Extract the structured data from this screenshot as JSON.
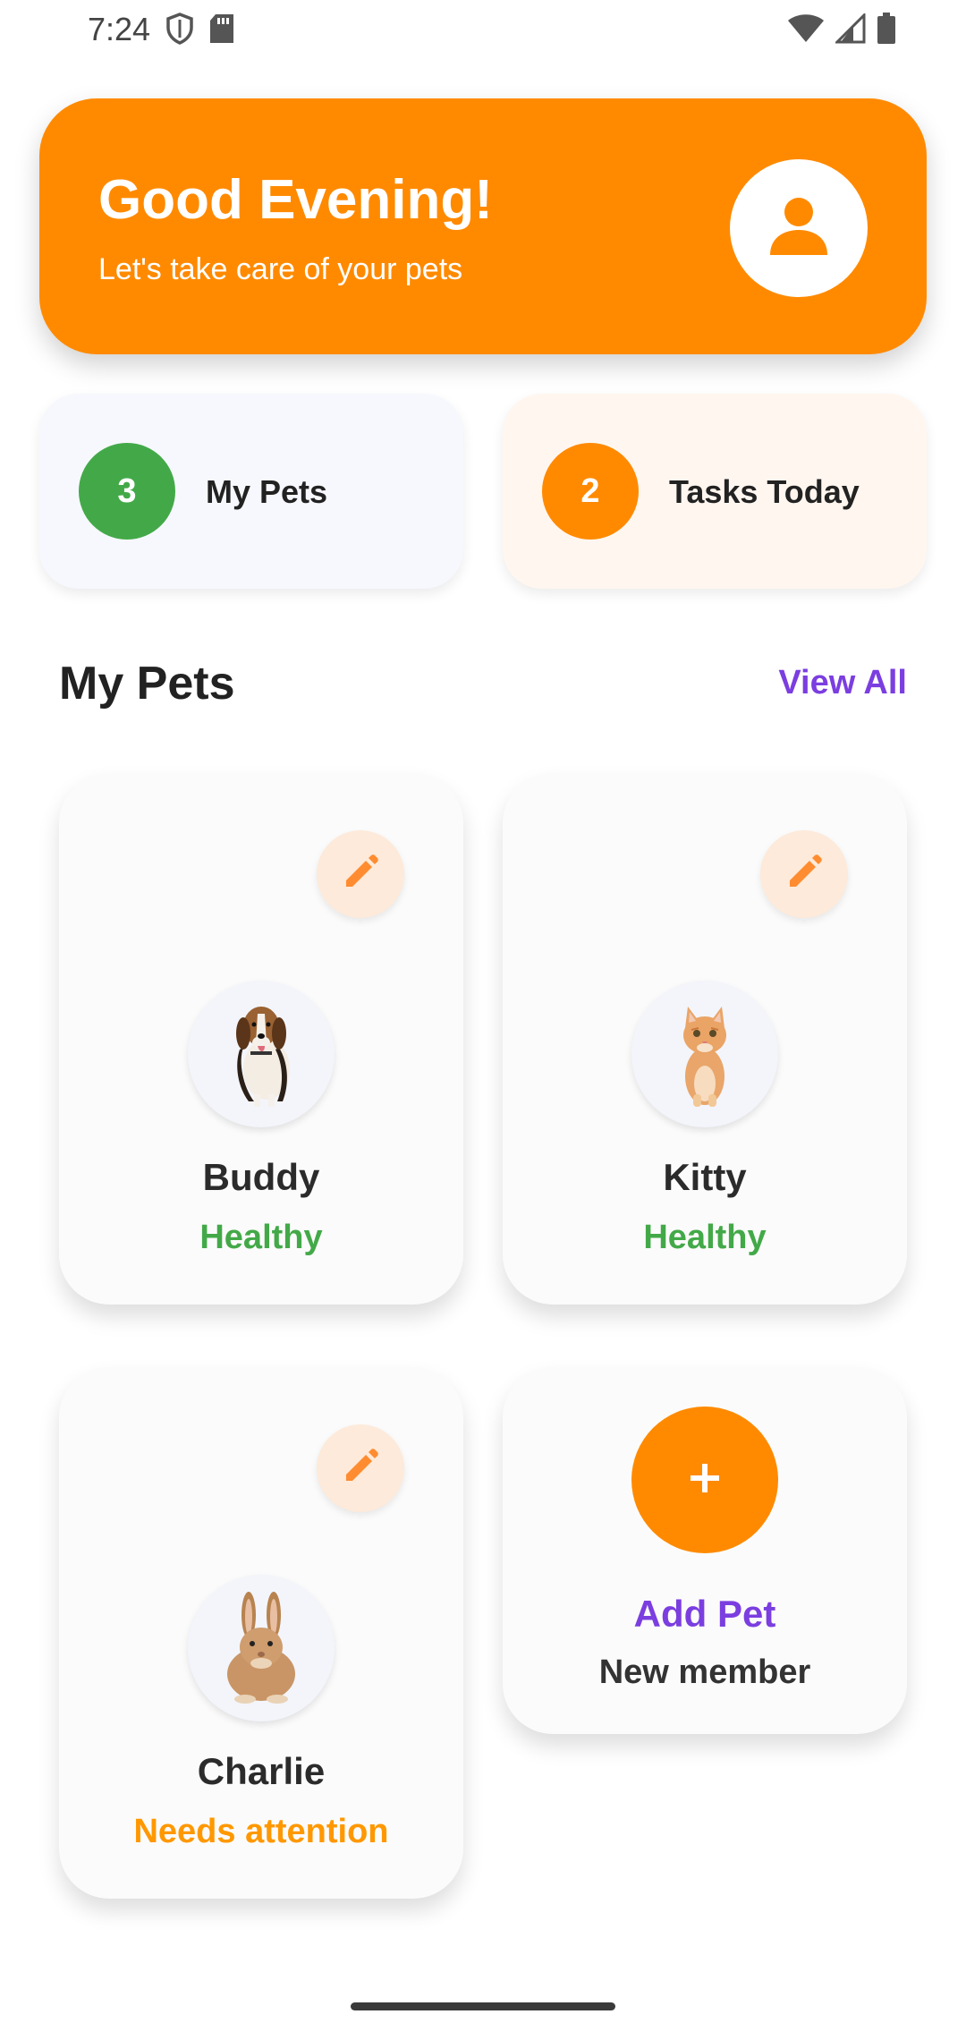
{
  "status_bar": {
    "time": "7:24",
    "icons": [
      "shield-icon",
      "sd-card-icon",
      "wifi-icon",
      "signal-icon",
      "battery-icon"
    ]
  },
  "header": {
    "greeting": "Good Evening!",
    "subtitle": "Let's take care of your pets",
    "profile_icon": "person-icon",
    "background_color": "#ff8a00"
  },
  "stats": [
    {
      "count": "3",
      "label": "My Pets",
      "badge_color": "#43a948"
    },
    {
      "count": "2",
      "label": "Tasks Today",
      "badge_color": "#ff8a00"
    }
  ],
  "section": {
    "title": "My Pets",
    "view_all": "View All"
  },
  "pets": [
    {
      "name": "Buddy",
      "status": "Healthy",
      "status_color": "#43a948",
      "image": "beagle-dog-photo"
    },
    {
      "name": "Kitty",
      "status": "Healthy",
      "status_color": "#43a948",
      "image": "orange-kitten-photo"
    },
    {
      "name": "Charlie",
      "status": "Needs attention",
      "status_color": "#ff9800",
      "image": "brown-rabbit-photo"
    }
  ],
  "add_pet": {
    "title": "Add Pet",
    "subtitle": "New member",
    "icon": "plus-icon"
  },
  "colors": {
    "accent": "#ff8a00",
    "purple": "#7b3ee0",
    "healthy": "#43a948",
    "warning": "#ff9800"
  }
}
